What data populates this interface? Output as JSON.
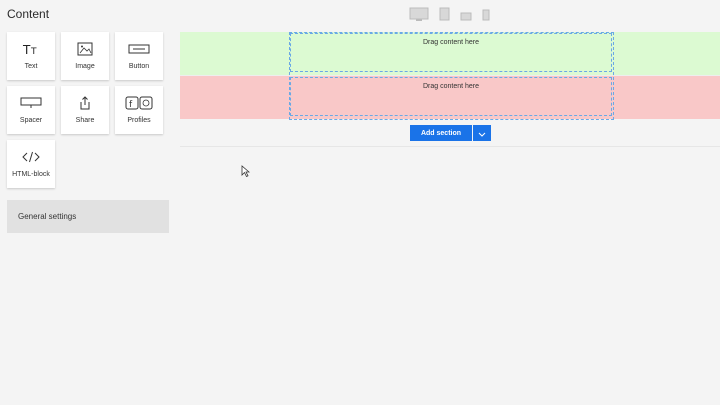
{
  "panel": {
    "title": "Content",
    "blocks": [
      {
        "label": "Text",
        "icon": "text-icon"
      },
      {
        "label": "Image",
        "icon": "image-icon"
      },
      {
        "label": "Button",
        "icon": "button-icon"
      },
      {
        "label": "Spacer",
        "icon": "spacer-icon"
      },
      {
        "label": "Share",
        "icon": "share-icon"
      },
      {
        "label": "Profiles",
        "icon": "profiles-icon"
      },
      {
        "label": "HTML-block",
        "icon": "code-icon"
      }
    ],
    "settings_label": "General settings"
  },
  "canvas": {
    "sections": [
      {
        "placeholder": "Drag content here",
        "color": "#dcfad2"
      },
      {
        "placeholder": "Drag content here",
        "color": "#f9c8c8"
      }
    ],
    "add_section_label": "Add section"
  },
  "toolbar": {
    "devices": [
      "desktop-icon",
      "tablet-icon",
      "landscape-icon",
      "mobile-icon"
    ]
  },
  "colors": {
    "accent": "#1a73e8",
    "dropzone_border": "#6aa9e6"
  }
}
